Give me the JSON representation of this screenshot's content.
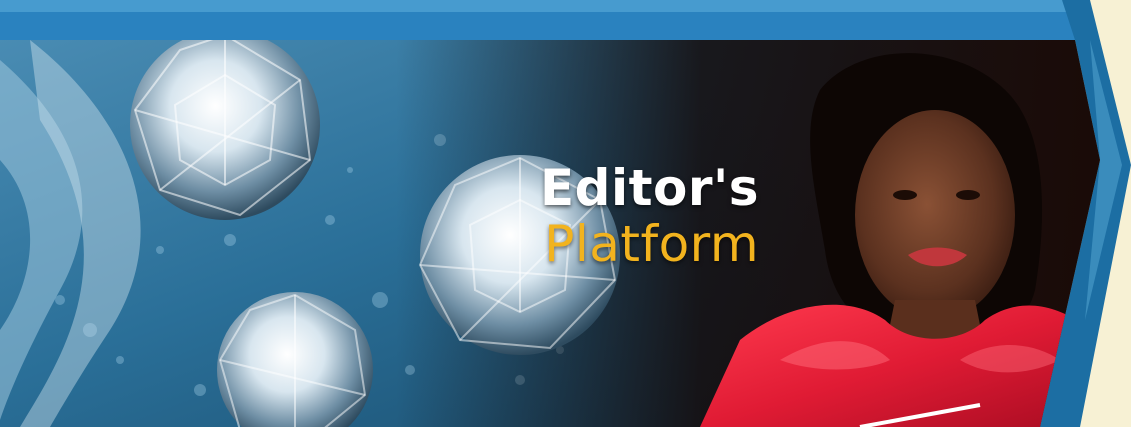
{
  "banner": {
    "title_line_1": "Editor's",
    "title_line_2": "Platform"
  },
  "colors": {
    "page_background": "#f7f1d4",
    "frame_blue": "#1c6ea3",
    "frame_light_blue": "#5fb1dc",
    "water_blue": "#2b6e97",
    "dark_background": "#140806",
    "title_white": "#ffffff",
    "title_gold": "#f2b31e",
    "dress_red": "#e01b34"
  },
  "icons": {
    "diamonds": "diamond-gem-icon",
    "wave": "swoosh-decoration-icon"
  }
}
